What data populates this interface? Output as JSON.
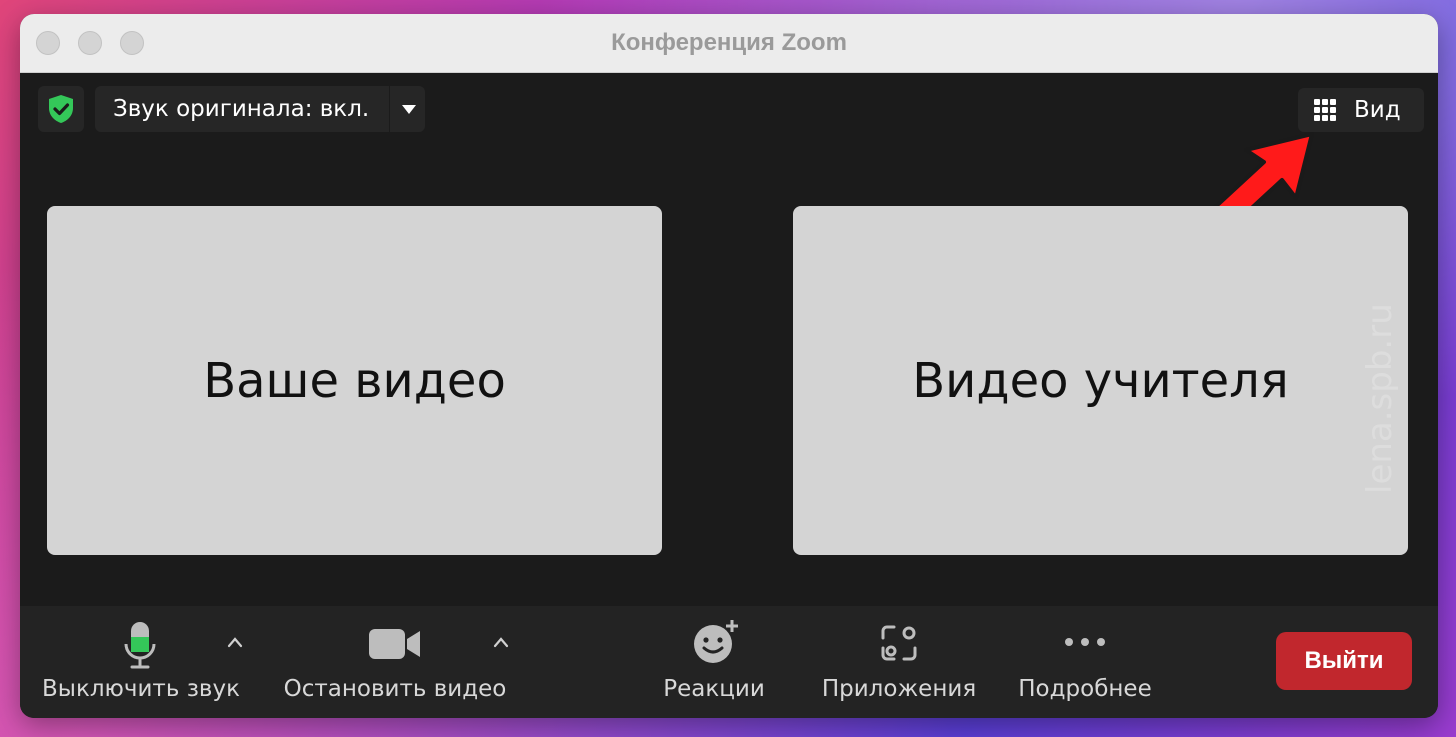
{
  "window": {
    "title": "Конференция Zoom"
  },
  "topbar": {
    "audio_label": "Звук оригинала: вкл.",
    "view_label": "Вид"
  },
  "tiles": {
    "left_label": "Ваше видео",
    "right_label": "Видео учителя"
  },
  "watermark": "lena.spb.ru",
  "toolbar": {
    "mute_label": "Выключить звук",
    "stop_video_label": "Остановить видео",
    "reactions_label": "Реакции",
    "apps_label": "Приложения",
    "more_label": "Подробнее",
    "leave_label": "Выйти"
  },
  "colors": {
    "accent_green": "#34c759",
    "leave_red": "#c1272d",
    "annotation_arrow": "#ff1a1a"
  },
  "icons": {
    "security": "shield-check-icon",
    "view": "grid-icon",
    "mute": "microphone-icon",
    "video": "video-camera-icon",
    "reactions": "smiley-plus-icon",
    "apps": "apps-icon",
    "more": "ellipsis-icon",
    "menu_caret": "caret-down-icon",
    "chevron": "chevron-up-icon"
  }
}
